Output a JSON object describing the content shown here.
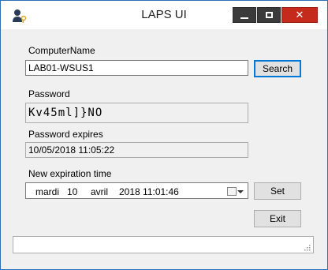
{
  "window": {
    "title": "LAPS UI",
    "controls": {
      "minimize": "minimize",
      "maximize": "maximize",
      "close": "✕"
    }
  },
  "form": {
    "computer_name_label": "ComputerName",
    "computer_name_value": "LAB01-WSUS1",
    "search_button": "Search",
    "password_label": "Password",
    "password_value": "Kv45ml]}NO",
    "password_expires_label": "Password expires",
    "password_expires_value": "10/05/2018 11:05:22",
    "new_expiration_label": "New expiration time",
    "new_expiration": {
      "weekday": "mardi",
      "day": "10",
      "month": "avril",
      "year_time": "2018 11:01:46"
    },
    "set_button": "Set",
    "exit_button": "Exit"
  },
  "status_bar": {
    "text": ""
  },
  "colors": {
    "close_button": "#c42b1c",
    "accent_border": "#0078d7",
    "window_border": "#2b6fb6"
  }
}
